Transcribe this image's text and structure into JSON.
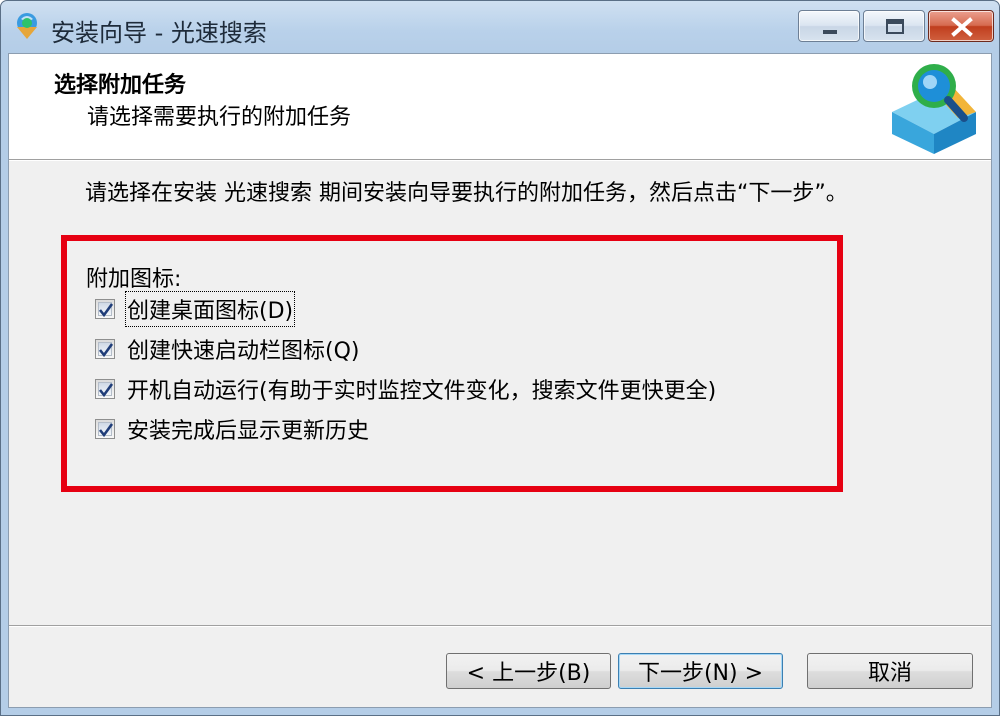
{
  "window": {
    "title": "安装向导 - 光速搜索"
  },
  "header": {
    "title": "选择附加任务",
    "subtitle": "请选择需要执行的附加任务"
  },
  "instruction": "请选择在安装 光速搜索 期间安装向导要执行的附加任务，然后点击“下一步”。",
  "tasks": {
    "group_label": "附加图标:",
    "items": [
      {
        "label": "创建桌面图标(D)",
        "checked": true
      },
      {
        "label": "创建快速启动栏图标(Q)",
        "checked": true
      },
      {
        "label": "开机自动运行(有助于实时监控文件变化，搜索文件更快更全)",
        "checked": true
      },
      {
        "label": "安装完成后显示更新历史",
        "checked": true
      }
    ]
  },
  "buttons": {
    "back": "< 上一步(B)",
    "next": "下一步(N) >",
    "cancel": "取消"
  },
  "colors": {
    "highlight": "#e60012",
    "title_bar": "#b9d1ea",
    "close_button": "#c03e1e"
  },
  "icons": {
    "app": "search-globe-icon",
    "header_logo": "magnifier-box-logo",
    "checkmark": "checkmark-icon"
  }
}
